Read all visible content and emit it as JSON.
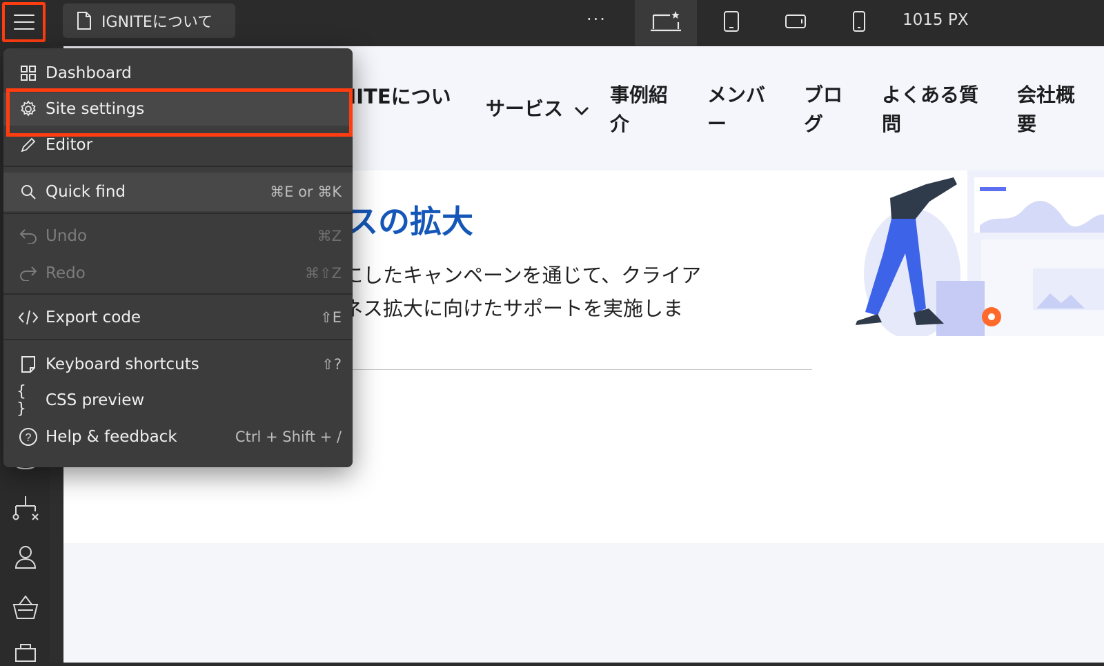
{
  "topbar": {
    "page_tab_label": "IGNITEについて",
    "more_label": "···",
    "viewport_width_label": "1015 PX"
  },
  "canvas": {
    "logo_partial": "NITEについ",
    "nav": [
      {
        "label": "サービス"
      },
      {
        "label": "事例紹\n介"
      },
      {
        "label": "メンバ\nー"
      },
      {
        "label": "ブロ\nグ"
      },
      {
        "label": "よくある質\n問"
      },
      {
        "label": "会社概\n要"
      }
    ],
    "hero_title_partial": "スの拡大",
    "hero_body_line1": "にしたキャンペーンを通じて、クライア",
    "hero_body_line2": "ネス拡大に向けたサポートを実施しま"
  },
  "menu": {
    "items": [
      {
        "label": "Dashboard",
        "shortcut": "",
        "icon": "grid-icon"
      },
      {
        "label": "Site settings",
        "shortcut": "",
        "icon": "gear-icon"
      },
      {
        "label": "Editor",
        "shortcut": "",
        "icon": "pencil-icon"
      },
      {
        "label": "Quick find",
        "shortcut": "⌘E or ⌘K",
        "icon": "search-icon"
      },
      {
        "label": "Undo",
        "shortcut": "⌘Z",
        "icon": "undo-icon"
      },
      {
        "label": "Redo",
        "shortcut": "⌘⇧Z",
        "icon": "redo-icon"
      },
      {
        "label": "Export code",
        "shortcut": "⇧E",
        "icon": "code-icon"
      },
      {
        "label": "Keyboard shortcuts",
        "shortcut": "⇧?",
        "icon": "keyboard-icon"
      },
      {
        "label": "CSS preview",
        "shortcut": "",
        "icon": "braces-icon"
      },
      {
        "label": "Help & feedback",
        "shortcut": "Ctrl + Shift + /",
        "icon": "help-icon"
      }
    ]
  },
  "colors": {
    "highlight": "#ff3d11",
    "accent_blue": "#1557b8",
    "menu_bg": "#3c3c3c",
    "chrome_bg": "#2b2b2b"
  }
}
